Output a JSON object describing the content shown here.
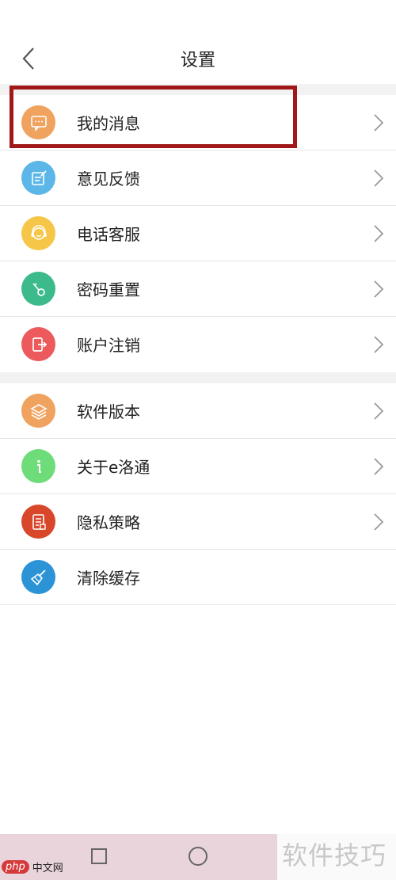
{
  "header": {
    "title": "设置",
    "back_icon": "chevron-left-icon"
  },
  "section1": [
    {
      "label": "我的消息",
      "icon": "message-icon",
      "color": "#f0a25f"
    },
    {
      "label": "意见反馈",
      "icon": "feedback-edit-icon",
      "color": "#5cb7e8"
    },
    {
      "label": "电话客服",
      "icon": "headset-icon",
      "color": "#f6c648"
    },
    {
      "label": "密码重置",
      "icon": "key-icon",
      "color": "#3dba8c"
    },
    {
      "label": "账户注销",
      "icon": "logout-icon",
      "color": "#ec5a5d"
    }
  ],
  "section2": [
    {
      "label": "软件版本",
      "icon": "layers-icon",
      "color": "#f0a25f"
    },
    {
      "label": "关于e洛通",
      "icon": "info-icon",
      "color": "#6fdc7a"
    },
    {
      "label": "隐私策略",
      "icon": "document-icon",
      "color": "#d9472b"
    },
    {
      "label": "清除缓存",
      "icon": "broom-icon",
      "color": "#2b93d6"
    }
  ],
  "watermark": {
    "php_badge": "php",
    "php_site": "中文网",
    "right_text": "软件技巧"
  },
  "highlight_color": "#a01818"
}
